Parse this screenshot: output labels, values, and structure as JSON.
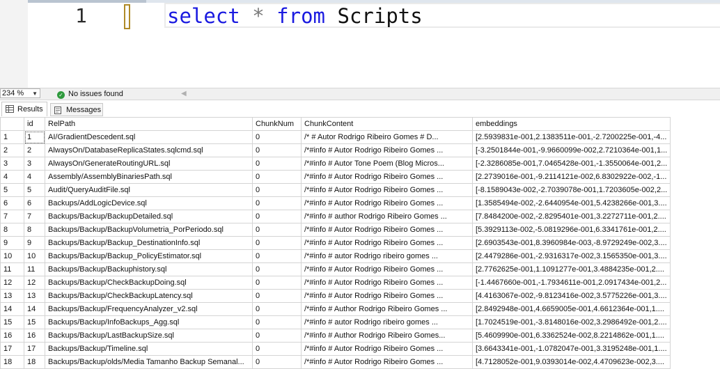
{
  "editor": {
    "line_number": "1",
    "code": {
      "kw_select": "select",
      "op_star": "*",
      "kw_from": "from",
      "table": "Scripts"
    }
  },
  "status": {
    "zoom": "234 %",
    "issues": "No issues found"
  },
  "tabs": {
    "results": "Results",
    "messages": "Messages"
  },
  "grid": {
    "columns": [
      "id",
      "RelPath",
      "ChunkNum",
      "ChunkContent",
      "embeddings"
    ],
    "rows": [
      {
        "n": "1",
        "id": "1",
        "path": "AI/GradientDescedent.sql",
        "chunk": "0",
        "content": "/*   # Autor     Rodrigo Ribeiro Gomes       # D...",
        "emb": "[2.5939831e-001,2.1383511e-001,-2.7200225e-001,-4..."
      },
      {
        "n": "2",
        "id": "2",
        "path": "AlwaysOn/DatabaseReplicaStates.sqlcmd.sql",
        "chunk": "0",
        "content": "/*#info     # Autor     Rodrigo Ribeiro Gomes   ...",
        "emb": "[-3.2501844e-001,-9.9660099e-002,2.7210364e-001,1..."
      },
      {
        "n": "3",
        "id": "3",
        "path": "AlwaysOn/GenerateRoutingURL.sql",
        "chunk": "0",
        "content": "/*#info     # Autor     Tone Poem (Blog Micros...",
        "emb": "[-2.3286085e-001,7.0465428e-001,-1.3550064e-001,2..."
      },
      {
        "n": "4",
        "id": "4",
        "path": "Assembly/AssemblyBinariesPath.sql",
        "chunk": "0",
        "content": "/*#info     # Autor     Rodrigo Ribeiro Gomes   ...",
        "emb": "[2.2739016e-001,-9.2114121e-002,6.8302922e-002,-1..."
      },
      {
        "n": "5",
        "id": "5",
        "path": "Audit/QueryAuditFile.sql",
        "chunk": "0",
        "content": "/*#info     # Autor     Rodrigo Ribeiro Gomes   ...",
        "emb": "[-8.1589043e-002,-2.7039078e-001,1.7203605e-002,2..."
      },
      {
        "n": "6",
        "id": "6",
        "path": "Backups/AddLogicDevice.sql",
        "chunk": "0",
        "content": "/*#info     # Autor     Rodrigo Ribeiro Gomes   ...",
        "emb": "[1.3585494e-002,-2.6440954e-001,5.4238266e-001,3...."
      },
      {
        "n": "7",
        "id": "7",
        "path": "Backups/Backup/BackupDetailed.sql",
        "chunk": "0",
        "content": "/*#info     # author     Rodrigo Ribeiro Gomes   ...",
        "emb": "[7.8484200e-002,-2.8295401e-001,3.2272711e-001,2...."
      },
      {
        "n": "8",
        "id": "8",
        "path": "Backups/Backup/BackupVolumetria_PorPeriodo.sql",
        "chunk": "0",
        "content": "/*#info     # Autor     Rodrigo Ribeiro Gomes   ...",
        "emb": "[5.3929113e-002,-5.0819296e-001,6.3341761e-001,2...."
      },
      {
        "n": "9",
        "id": "9",
        "path": "Backups/Backup/Backup_DestinationInfo.sql",
        "chunk": "0",
        "content": "/*#info     # Autor     Rodrigo Ribeiro Gomes   ...",
        "emb": "[2.6903543e-001,8.3960984e-003,-8.9729249e-002,3...."
      },
      {
        "n": "10",
        "id": "10",
        "path": "Backups/Backup/Backup_PolicyEstimator.sql",
        "chunk": "0",
        "content": "/*#info     # autor     Rodrigo ribeiro gomes   ...",
        "emb": "[2.4479286e-001,-2.9316317e-002,3.1565350e-001,3...."
      },
      {
        "n": "11",
        "id": "11",
        "path": "Backups/Backup/Backuphistory.sql",
        "chunk": "0",
        "content": "/*#info      # Autor     Rodrigo Ribeiro Gomes   ...",
        "emb": "[2.7762625e-001,1.1091277e-001,3.4884235e-001,2...."
      },
      {
        "n": "12",
        "id": "12",
        "path": "Backups/Backup/CheckBackupDoing.sql",
        "chunk": "0",
        "content": "/*#info     # Autor     Rodrigo Ribeiro Gomes   ...",
        "emb": "[-1.4467660e-001,-1.7934611e-001,2.0917434e-001,2..."
      },
      {
        "n": "13",
        "id": "13",
        "path": "Backups/Backup/CheckBackupLatency.sql",
        "chunk": "0",
        "content": "/*#info     # Autor     Rodrigo Ribeiro Gomes   ...",
        "emb": "[4.4163067e-002,-9.8123416e-002,3.5775226e-001,3...."
      },
      {
        "n": "14",
        "id": "14",
        "path": "Backups/Backup/FrequencyAnalyzer_v2.sql",
        "chunk": "0",
        "content": "/*#info      # Author     Rodrigo Ribeiro Gomes   ...",
        "emb": "[2.8492948e-001,4.6659005e-001,4.6612364e-001,1...."
      },
      {
        "n": "15",
        "id": "15",
        "path": "Backups/Backup/InfoBackups_Agg.sql",
        "chunk": "0",
        "content": "/*#info     # autor     Rodrigo ribeiro gomes   ...",
        "emb": "[1.7024519e-001,-3.8148016e-002,3.2986492e-001,2...."
      },
      {
        "n": "16",
        "id": "16",
        "path": "Backups/Backup/LastBackupSize.sql",
        "chunk": "0",
        "content": "/*#info      # Author     Rodrigo Ribeiro Gomes...",
        "emb": "[5.4609990e-001,6.3362524e-002,8.2214862e-001,1...."
      },
      {
        "n": "17",
        "id": "17",
        "path": "Backups/Backup/Timeline.sql",
        "chunk": "0",
        "content": "/*#info     # Autor     Rodrigo Ribeiro Gomes   ...",
        "emb": "[3.6643341e-001,-1.0782047e-001,3.3195248e-001,1...."
      },
      {
        "n": "18",
        "id": "18",
        "path": "Backups/Backup/olds/Media Tamanho Backup Semanal...",
        "chunk": "0",
        "content": "/*#info     # Autor     Rodrigo Ribeiro Gomes   ...",
        "emb": "[4.7128052e-001,9.0393014e-002,4.4709623e-002,3...."
      }
    ]
  }
}
